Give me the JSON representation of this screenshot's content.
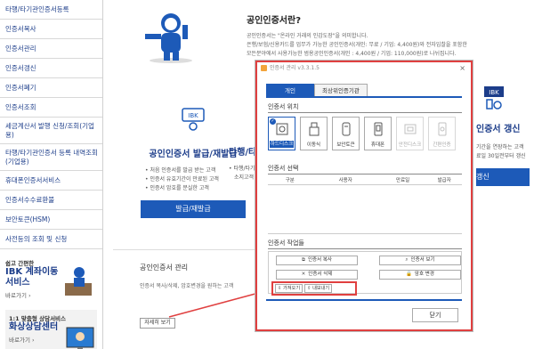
{
  "sidebar": {
    "items": [
      {
        "label": "타행/타기관인증서등록"
      },
      {
        "label": "인증서복사"
      },
      {
        "label": "인증서관리"
      },
      {
        "label": "인증서갱신"
      },
      {
        "label": "인증서폐기"
      },
      {
        "label": "인증서조회"
      },
      {
        "label": "세금계산서 발행 신청/조회(기업용)"
      },
      {
        "label": "타행/타기관인증서 등록 내역조회(기업용)"
      },
      {
        "label": "휴대폰인증서서비스"
      },
      {
        "label": "인증서수수료환불"
      },
      {
        "label": "보안토큰(HSM)"
      },
      {
        "label": "사전등의 조회 및 신청"
      }
    ],
    "ad1": {
      "small": "쉽고 간편한",
      "big1": "IBK 계좌이동",
      "big2": "서비스",
      "link": "바로가기 ›"
    },
    "ad2": {
      "small": "1:1 맞춤형 상담서비스",
      "big": "화상상담센터",
      "link": "바로가기 ›"
    }
  },
  "intro": {
    "title": "공인인증서란?",
    "line1": "공인인증서는 \"온라인 거래의 인감도장\"을 의미합니다.",
    "line2": "은행/보험/신용카드를 업무가 가능한 공인인증서(개인: 무료 / 기업: 4,400원)와 전자입찰을 포함한",
    "line3": "모든분야에서 사용가능한 범용공인인증서(개인 : 4,400원 / 기업: 110,000원)로 나뉘집니다."
  },
  "card_issue": {
    "title": "공인인증서 발급/재발급",
    "bullets": [
      "처음 인증서를 발급 받는 고객",
      "인증서 유효기간이 만료된 고객",
      "인증서 암호를 분실한 고객"
    ],
    "button": "발급/재발급"
  },
  "card_other": {
    "title": "타행/타",
    "bullets": [
      "타행/타기관",
      "소지고객"
    ]
  },
  "card_renew": {
    "badge": "IBK",
    "title": "인증서 갱신",
    "bullets": [
      "기간을 연장하는 고객",
      "료일 30일전부터 갱신"
    ],
    "button": "갱신"
  },
  "mgmt": {
    "title": "공인인증서 관리",
    "desc": "인증서 복사/삭제, 암호변경을 원하는 고객",
    "button": "자세히 보기"
  },
  "dialog": {
    "title": "인증서 관리 v3.3.1.5",
    "close": "×",
    "tabs": [
      "개인",
      "최상위인증기관"
    ],
    "location_label": "인증서 위치",
    "locations": [
      {
        "label": "하드디스크",
        "icon": "hard-disk-icon",
        "selected": true,
        "disabled": false
      },
      {
        "label": "이동식",
        "icon": "usb-icon",
        "selected": false,
        "disabled": false
      },
      {
        "label": "보안토큰",
        "icon": "token-icon",
        "selected": false,
        "disabled": false
      },
      {
        "label": "휴대폰",
        "icon": "phone-icon",
        "selected": false,
        "disabled": false
      },
      {
        "label": "안전디스크",
        "icon": "safe-disk-icon",
        "selected": false,
        "disabled": true
      },
      {
        "label": "간편인증",
        "icon": "simple-auth-icon",
        "selected": false,
        "disabled": true
      }
    ],
    "select_label": "인증서 선택",
    "columns": [
      "구분",
      "사용자",
      "만료일",
      "발급자"
    ],
    "ops_label": "인증서 작업들",
    "ops": {
      "copy": "인증서 복사",
      "view": "인증서 보기",
      "delete": "인증서 삭제",
      "change_pw": "암호 변경",
      "import": "가져오기",
      "export": "내보내기"
    },
    "close_button": "닫기"
  },
  "colors": {
    "accent": "#1d5ab8",
    "highlight": "#e04040",
    "sidebar_text": "#1c3d8a"
  }
}
